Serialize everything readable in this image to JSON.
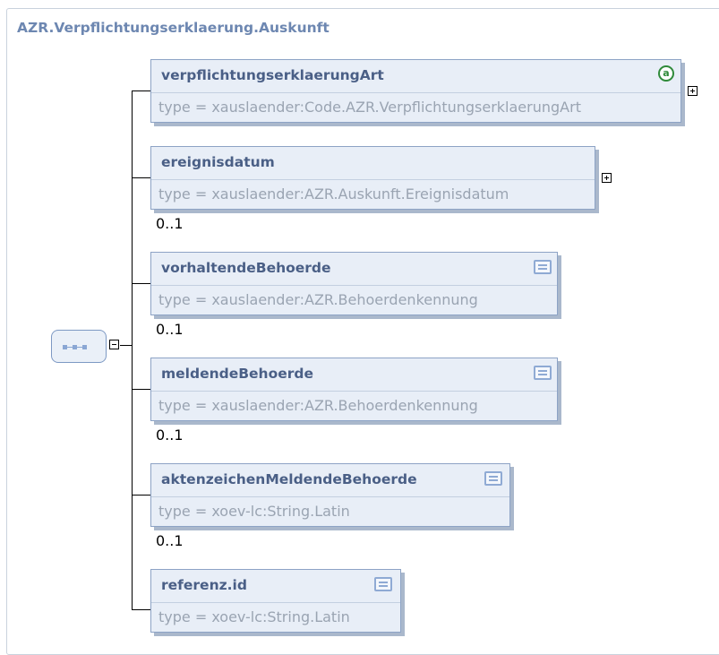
{
  "diagram": {
    "title": "AZR.Verpflichtungserklaerung.Auskunft",
    "elements": [
      {
        "name": "verpflichtungserklaerungArt",
        "type": "type = xauslaender:Code.AZR.VerpflichtungserklaerungArt",
        "icon": "attribute-icon",
        "expand_toggle": "plus"
      },
      {
        "name": "ereignisdatum",
        "type": "type = xauslaender:AZR.Auskunft.Ereignisdatum",
        "icon": "",
        "expand_toggle": "plus",
        "cardinality": "0..1"
      },
      {
        "name": "vorhaltendeBehoerde",
        "type": "type = xauslaender:AZR.Behoerdenkennung",
        "icon": "documentation-icon",
        "cardinality": "0..1"
      },
      {
        "name": "meldendeBehoerde",
        "type": "type = xauslaender:AZR.Behoerdenkennung",
        "icon": "documentation-icon",
        "cardinality": "0..1"
      },
      {
        "name": "aktenzeichenMeldendeBehoerde",
        "type": "type = xoev-lc:String.Latin",
        "icon": "documentation-icon",
        "cardinality": "0..1"
      },
      {
        "name": "referenz.id",
        "type": "type = xoev-lc:String.Latin",
        "icon": "documentation-icon"
      }
    ],
    "sequence": {
      "icon": "sequence-icon",
      "toggle": "minus"
    }
  }
}
